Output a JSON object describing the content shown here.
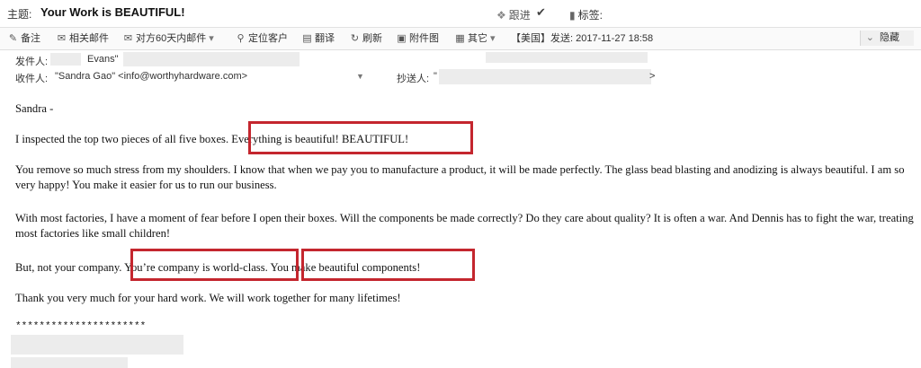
{
  "window": {
    "subject_label": "主题:",
    "subject": "Your Work is BEAUTIFUL!",
    "follow_up": "跟进",
    "tags_label": "标签:"
  },
  "toolbar": {
    "items": [
      {
        "label": "备注",
        "icon": "note-icon"
      },
      {
        "label": "相关邮件",
        "icon": "related-mail-icon"
      },
      {
        "label": "对方60天内邮件",
        "icon": "recent-mail-icon"
      },
      {
        "label": "定位客户",
        "icon": "locate-customer-icon"
      },
      {
        "label": "翻译",
        "icon": "translate-icon"
      },
      {
        "label": "刷新",
        "icon": "refresh-icon"
      },
      {
        "label": "附件图",
        "icon": "attachment-image-icon"
      },
      {
        "label": "其它",
        "icon": "more-icon"
      }
    ],
    "sent_info": "【美国】发送: 2017-11-27 18:58",
    "hide_label": "隐藏"
  },
  "headers": {
    "from_label": "发件人:",
    "from_name": "Evans\"",
    "to_label": "收件人:",
    "to_value": "\"Sandra Gao\" <info@worthyhardware.com>",
    "cc_label": "抄送人:",
    "cc_value": "\"",
    "cc_end": ">"
  },
  "body": {
    "greeting": "Sandra -",
    "para1": "I inspected the top two pieces of all five boxes. Everything is beautiful! BEAUTIFUL!",
    "para2": "You remove so much stress from my shoulders. I know that when we pay you to manufacture a product, it will be made perfectly. The glass bead blasting and anodizing is always beautiful. I am so very happy! You make it easier for us to run our business.",
    "para3": "With most factories, I have a moment of fear before I open their boxes. Will the components be made correctly? Do they care about quality? It is often a war. And Dennis has to fight the war, treating most factories like small children!",
    "para4": "But, not your company. You’re company is world-class. You make beautiful components!",
    "para5": "Thank you very much for your hard work. We will work together for many lifetimes!",
    "signature_stars": "**********************"
  },
  "colors": {
    "highlight": "#c4262e",
    "redaction": "#ececec"
  }
}
